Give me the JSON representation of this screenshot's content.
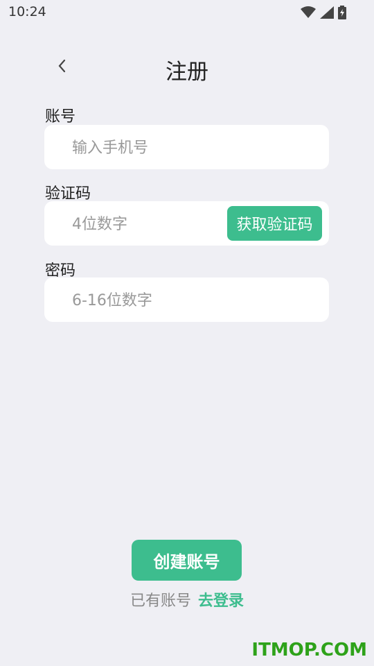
{
  "status_bar": {
    "time": "10:24",
    "icons": [
      "wifi-icon",
      "signal-icon",
      "battery-charging-icon"
    ]
  },
  "header": {
    "back_icon": "chevron-left-icon",
    "title": "注册"
  },
  "form": {
    "account": {
      "label": "账号",
      "placeholder": "输入手机号"
    },
    "verification": {
      "label": "验证码",
      "placeholder": "4位数字",
      "button": "获取验证码"
    },
    "password": {
      "label": "密码",
      "placeholder": "6-16位数字"
    }
  },
  "actions": {
    "create_account": "创建账号",
    "have_account": "已有账号",
    "go_login": "去登录"
  },
  "watermark": "ITMOP.COM",
  "colors": {
    "accent": "#3dbd8e",
    "background": "#efeff4",
    "watermark": "#2ea21a"
  }
}
